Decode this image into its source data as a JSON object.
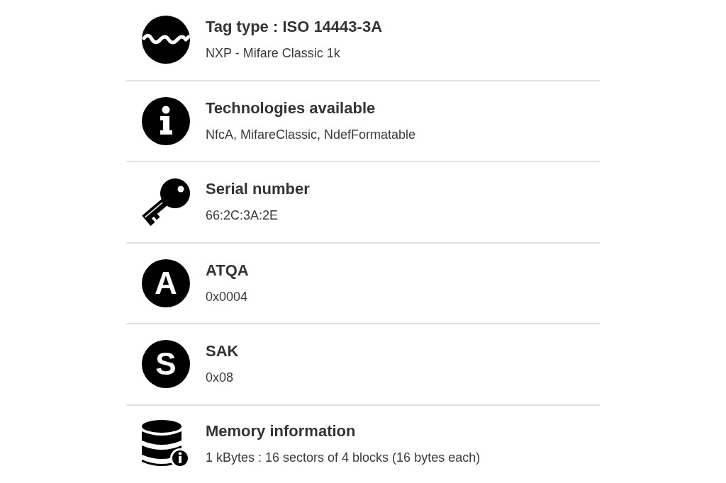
{
  "rows": [
    {
      "icon": {
        "kind": "wave"
      },
      "title": "Tag type : ISO 14443-3A",
      "value": "NXP - Mifare Classic 1k"
    },
    {
      "icon": {
        "kind": "info"
      },
      "title": "Technologies available",
      "value": "NfcA, MifareClassic, NdefFormatable"
    },
    {
      "icon": {
        "kind": "key"
      },
      "title": "Serial number",
      "value": "66:2C:3A:2E"
    },
    {
      "icon": {
        "kind": "letter",
        "text": "A"
      },
      "title": "ATQA",
      "value": "0x0004"
    },
    {
      "icon": {
        "kind": "letter",
        "text": "S"
      },
      "title": "SAK",
      "value": "0x08"
    },
    {
      "icon": {
        "kind": "database"
      },
      "title": "Memory information",
      "value": "1 kBytes : 16 sectors of 4 blocks (16 bytes each)"
    }
  ]
}
